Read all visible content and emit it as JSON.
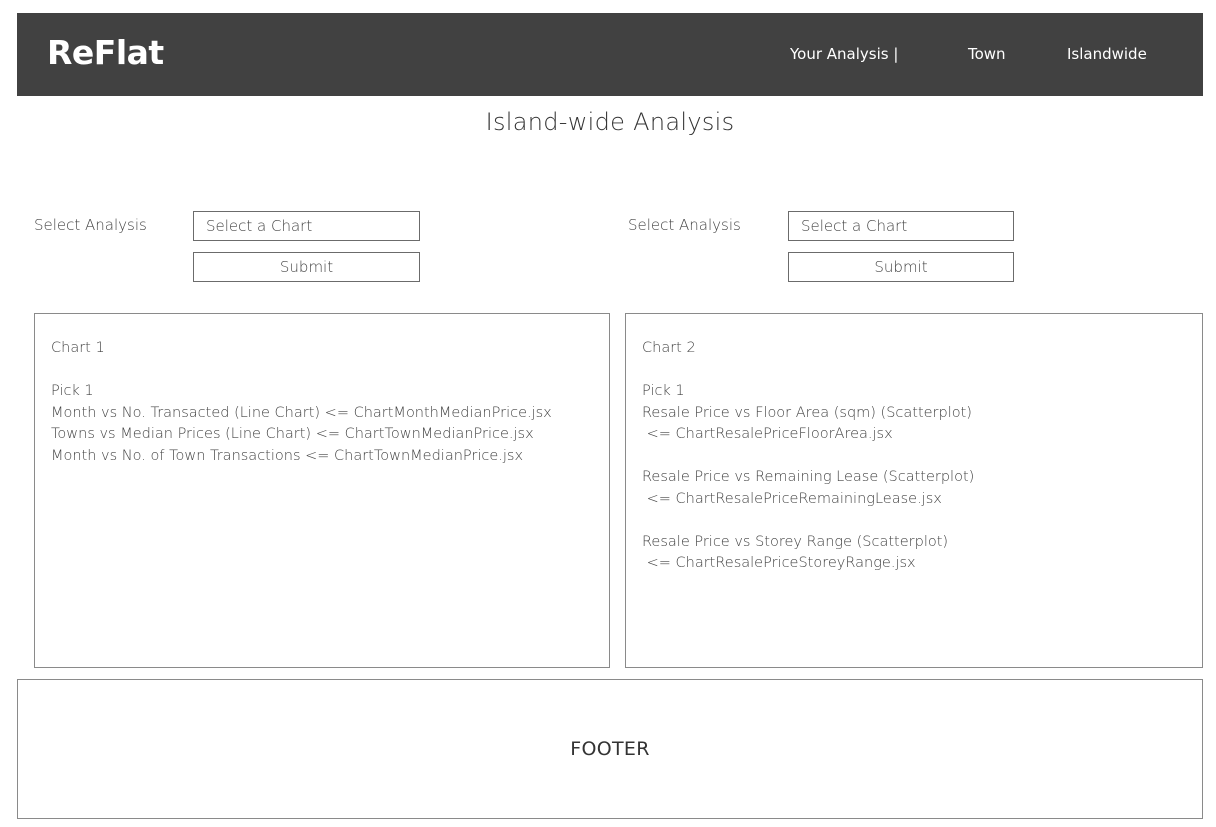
{
  "header": {
    "logo": "ReFlat",
    "nav": {
      "your_analysis": "Your Analysis |",
      "town": "Town",
      "islandwide": "Islandwide"
    }
  },
  "page": {
    "title": "Island-wide Analysis"
  },
  "left_controls": {
    "label": "Select Analysis",
    "select_placeholder": "Select a Chart",
    "submit_label": "Submit"
  },
  "right_controls": {
    "label": "Select Analysis",
    "select_placeholder": "Select a Chart",
    "submit_label": "Submit"
  },
  "chart1": {
    "title": "Chart 1",
    "pick": "Pick 1",
    "options": [
      "Month vs No. Transacted (Line Chart) <= ChartMonthMedianPrice.jsx",
      "Towns vs Median Prices (Line Chart) <= ChartTownMedianPrice.jsx",
      "Month vs No. of Town Transactions <= ChartTownMedianPrice.jsx"
    ]
  },
  "chart2": {
    "title": "Chart 2",
    "pick": "Pick 1",
    "options": [
      {
        "name": "Resale Price vs Floor Area (sqm) (Scatterplot)",
        "file": " <= ChartResalePriceFloorArea.jsx"
      },
      {
        "name": "Resale Price vs Remaining Lease (Scatterplot)",
        "file": " <= ChartResalePriceRemainingLease.jsx"
      },
      {
        "name": "Resale Price vs Storey Range (Scatterplot)",
        "file": " <= ChartResalePriceStoreyRange.jsx"
      }
    ]
  },
  "footer": {
    "text": "FOOTER"
  },
  "colors": {
    "navbar_bg": "#414141",
    "nav_text": "#ffffff",
    "border": "#8a8a8a"
  }
}
